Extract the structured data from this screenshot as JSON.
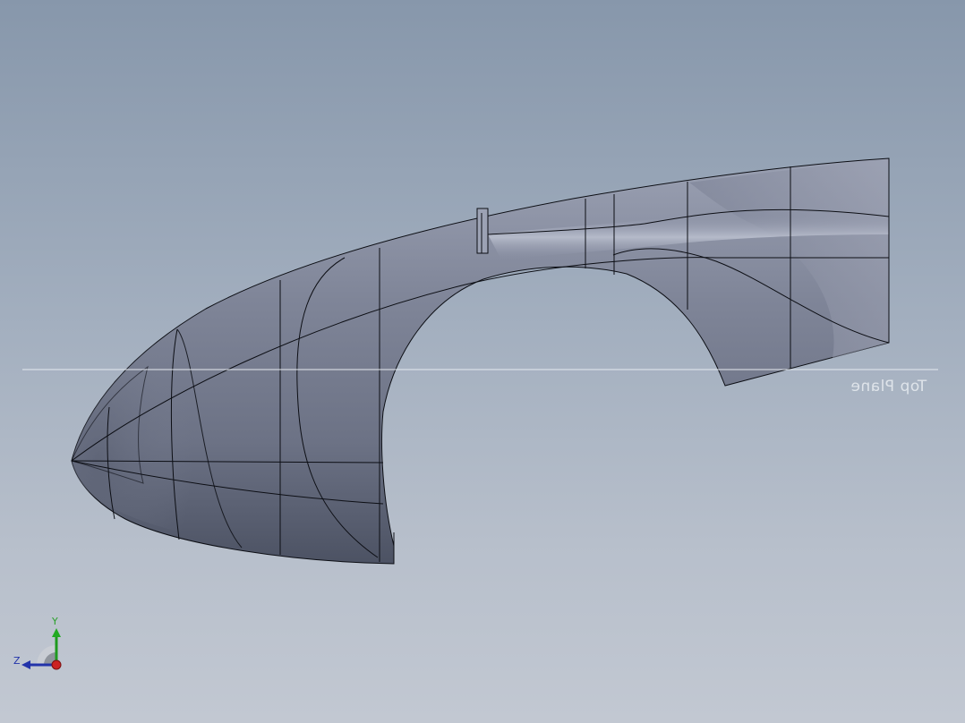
{
  "viewport": {
    "plane_label": "Top Plane",
    "triad": {
      "y_label": "Y",
      "z_label": "Z"
    }
  },
  "colors": {
    "background_top": "#8797ab",
    "background_bottom": "#c2c8d2",
    "surface": "#7d8396",
    "edge": "#0c0e14",
    "plane_line": "#e6eaf0",
    "axis_x": "#cc2222",
    "axis_y": "#22aa22",
    "axis_z": "#2233aa"
  },
  "icons": {
    "triad": "coordinate-triad-icon"
  }
}
